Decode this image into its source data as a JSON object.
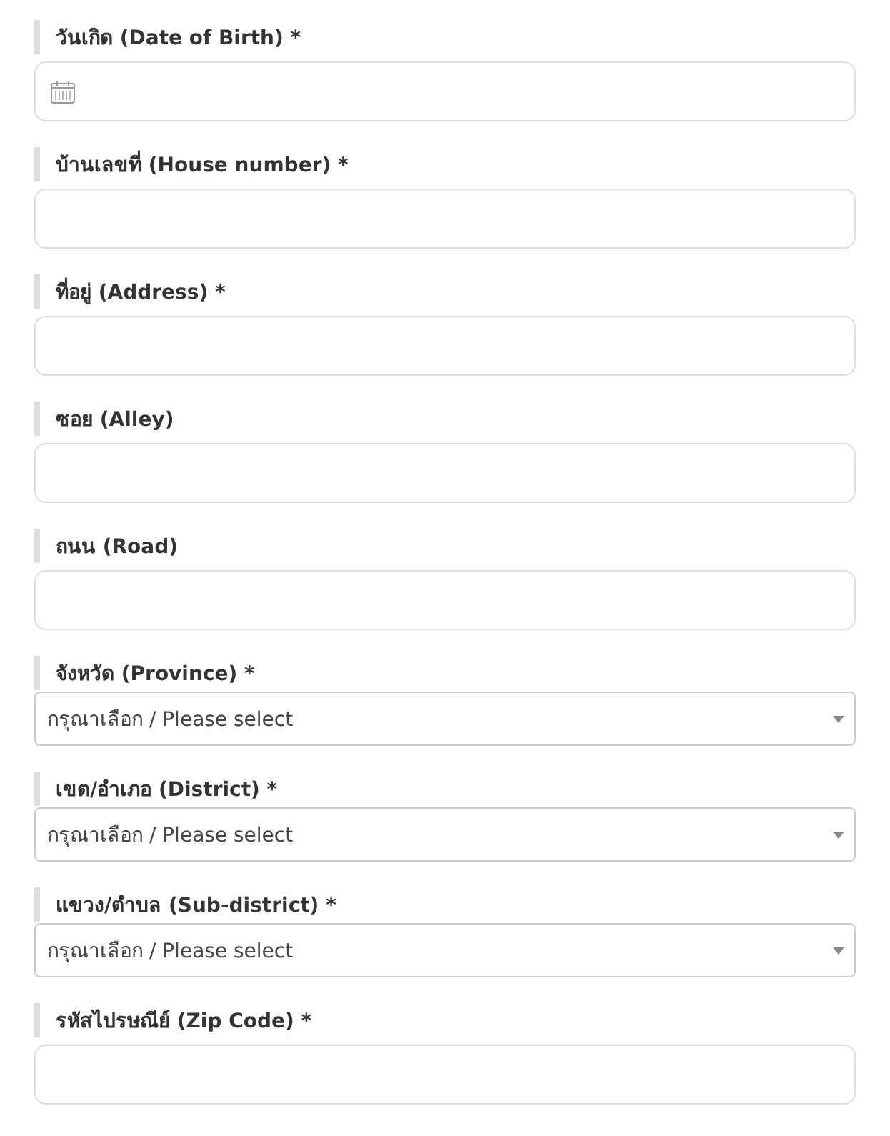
{
  "fields": [
    {
      "kind": "date",
      "label": "วันเกิด (Date of Birth) *"
    },
    {
      "kind": "text",
      "label": "บ้านเลขที่ (House number) *"
    },
    {
      "kind": "text",
      "label": "ที่อยู่ (Address) *"
    },
    {
      "kind": "text",
      "label": "ซอย (Alley)"
    },
    {
      "kind": "text",
      "label": "ถนน (Road)"
    },
    {
      "kind": "select",
      "label": "จังหวัด (Province) *",
      "value": "กรุณาเลือก / Please select"
    },
    {
      "kind": "select",
      "label": "เขต/อำเภอ (District) *",
      "value": "กรุณาเลือก / Please select"
    },
    {
      "kind": "select",
      "label": "แขวง/ตำบล (Sub-district) *",
      "value": "กรุณาเลือก / Please select"
    },
    {
      "kind": "text",
      "label": "รหัสไปรษณีย์ (Zip Code) *"
    }
  ]
}
